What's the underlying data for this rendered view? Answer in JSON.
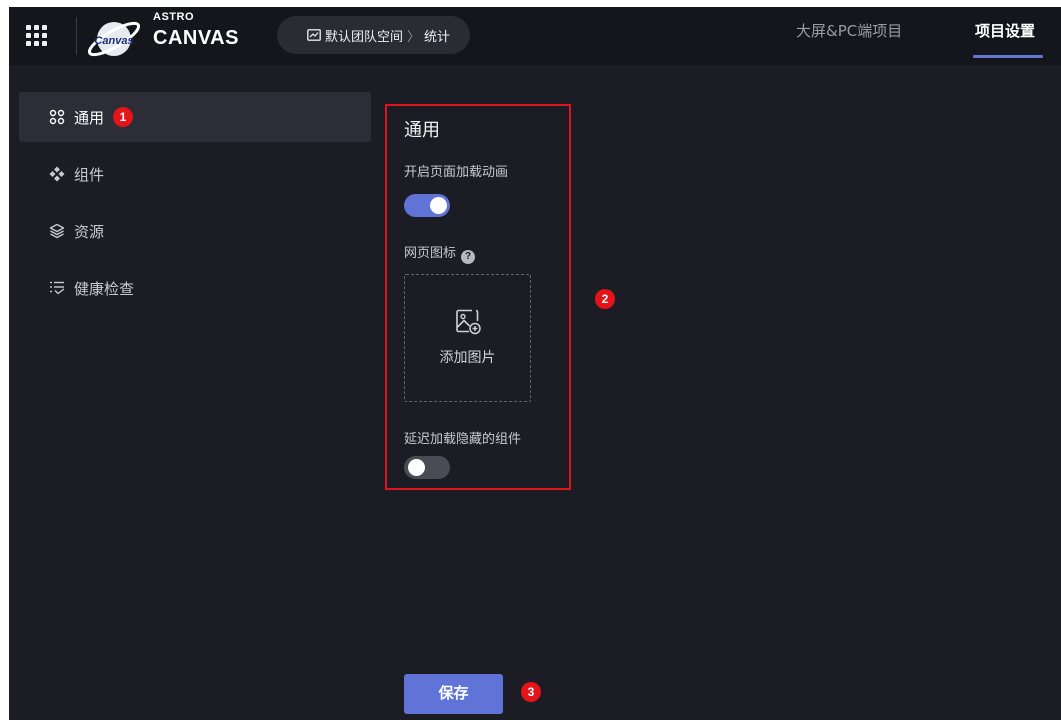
{
  "header": {
    "logo_top": "ASTRO",
    "logo_main": "CANVAS",
    "logo_badge": "Canvas",
    "breadcrumb": {
      "workspace": "默认团队空间",
      "separator": "〉",
      "current": "统计"
    },
    "tabs": [
      {
        "label": "大屏&PC端项目",
        "active": false
      },
      {
        "label": "项目设置",
        "active": true
      }
    ]
  },
  "sidebar": {
    "items": [
      {
        "label": "通用",
        "active": true,
        "icon": "grid-icon"
      },
      {
        "label": "组件",
        "active": false,
        "icon": "components-icon"
      },
      {
        "label": "资源",
        "active": false,
        "icon": "layers-icon"
      },
      {
        "label": "健康检查",
        "active": false,
        "icon": "checklist-icon"
      }
    ]
  },
  "settings": {
    "title": "通用",
    "page_animation": {
      "label": "开启页面加载动画",
      "enabled": true
    },
    "favicon": {
      "label": "网页图标",
      "help": "?",
      "upload_text": "添加图片"
    },
    "lazy_hidden": {
      "label": "延迟加载隐藏的组件",
      "enabled": false
    }
  },
  "footer": {
    "save_label": "保存"
  },
  "annotations": {
    "one": "1",
    "two": "2",
    "three": "3"
  },
  "colors": {
    "accent": "#5f74d6",
    "annotation": "#e5141a",
    "background": "#1c1d24"
  }
}
